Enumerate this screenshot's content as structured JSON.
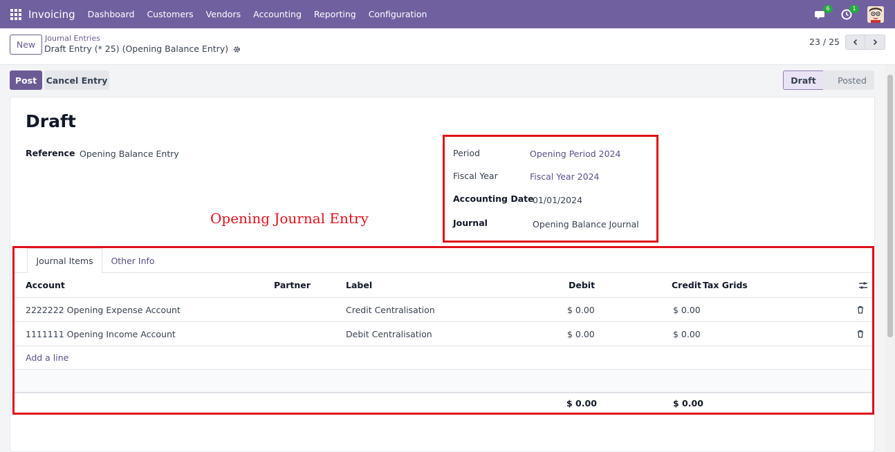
{
  "navbar": {
    "app_name": "Invoicing",
    "menu": [
      "Dashboard",
      "Customers",
      "Vendors",
      "Accounting",
      "Reporting",
      "Configuration"
    ],
    "messages_count": "6",
    "activities_count": "1"
  },
  "control_panel": {
    "new_label": "New",
    "breadcrumb": "Journal Entries",
    "record_title": "Draft Entry (* 25) (Opening Balance Entry)",
    "pager": "23 / 25"
  },
  "actions": {
    "post_label": "Post",
    "cancel_label": "Cancel Entry"
  },
  "statusbar": {
    "states": [
      "Draft",
      "Posted"
    ],
    "active": "Draft"
  },
  "form": {
    "state_title": "Draft",
    "reference_label": "Reference",
    "reference_value": "Opening Balance Entry",
    "period_label": "Period",
    "period_value": "Opening Period 2024",
    "fiscal_year_label": "Fiscal Year",
    "fiscal_year_value": "Fiscal Year 2024",
    "accounting_date_label": "Accounting Date",
    "accounting_date_value": "01/01/2024",
    "journal_label": "Journal",
    "journal_value": "Opening Balance Journal"
  },
  "annotation": "Opening Journal Entry",
  "notebook": {
    "tabs": [
      "Journal Items",
      "Other Info"
    ],
    "columns": {
      "account": "Account",
      "partner": "Partner",
      "label": "Label",
      "debit": "Debit",
      "credit": "Credit",
      "tax_grids": "Tax Grids"
    },
    "rows": [
      {
        "account": "2222222 Opening Expense Account",
        "partner": "",
        "label": "Credit Centralisation",
        "debit": "$ 0.00",
        "credit": "$ 0.00"
      },
      {
        "account": "1111111 Opening Income Account",
        "partner": "",
        "label": "Debit Centralisation",
        "debit": "$ 0.00",
        "credit": "$ 0.00"
      }
    ],
    "add_line": "Add a line",
    "total_debit": "$ 0.00",
    "total_credit": "$ 0.00"
  },
  "colors": {
    "navbar": "#7060a0",
    "primary": "#6b5b95",
    "annotation": "#e0101a"
  }
}
